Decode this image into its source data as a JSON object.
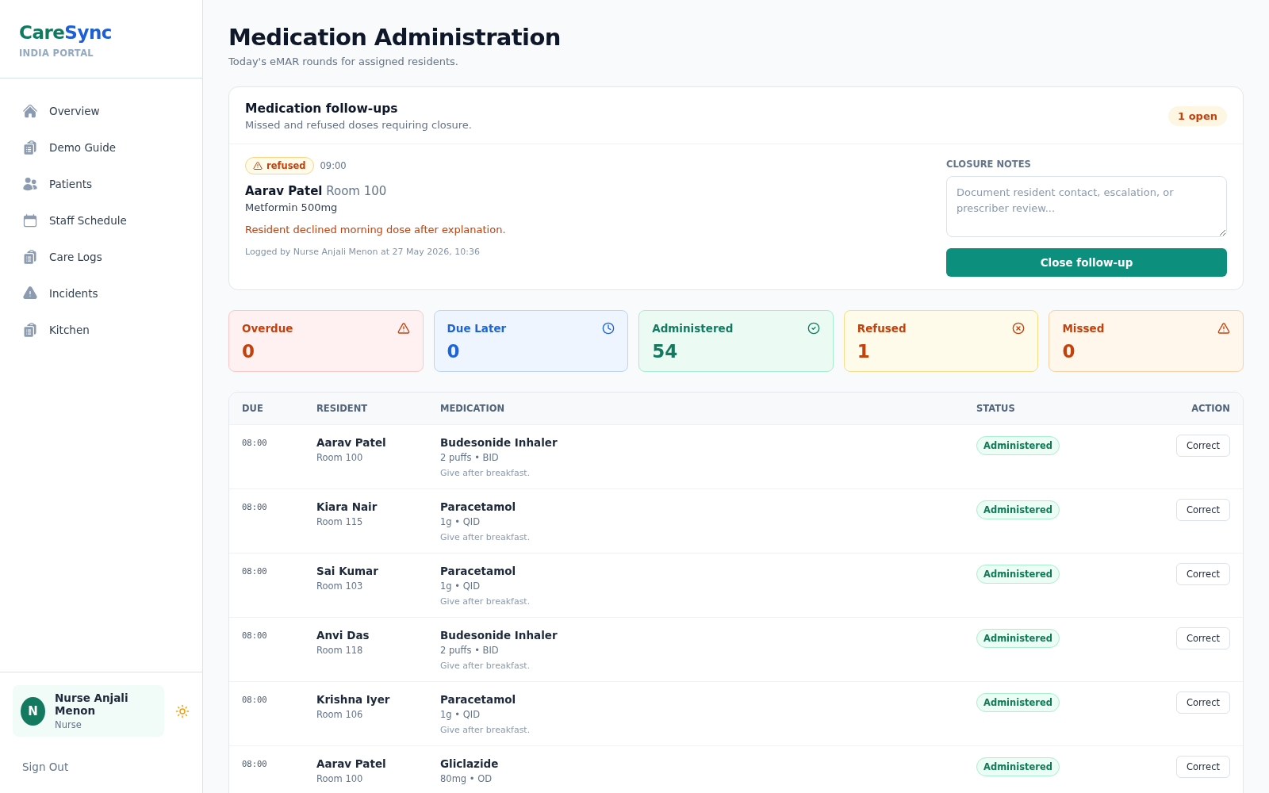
{
  "brand": {
    "name_a": "Care",
    "name_b": "Sync",
    "subtitle": "INDIA PORTAL"
  },
  "nav": [
    {
      "label": "Overview",
      "kind": "home"
    },
    {
      "label": "Demo Guide",
      "kind": "clipboard"
    },
    {
      "label": "Patients",
      "kind": "people"
    },
    {
      "label": "Staff Schedule",
      "kind": "calendar"
    },
    {
      "label": "Care Logs",
      "kind": "clipboard"
    },
    {
      "label": "Incidents",
      "kind": "alert"
    },
    {
      "label": "Kitchen",
      "kind": "clipboard"
    }
  ],
  "user": {
    "initial": "N",
    "name": "Nurse Anjali Menon",
    "role": "Nurse"
  },
  "sign_out": "Sign Out",
  "page": {
    "title": "Medication Administration",
    "subtitle": "Today's eMAR rounds for assigned residents."
  },
  "followups": {
    "title": "Medication follow-ups",
    "subtitle": "Missed and refused doses requiring closure.",
    "badge": "1 open",
    "item": {
      "status": "refused",
      "time": "09:00",
      "resident": "Aarav Patel",
      "room": "Room 100",
      "medication": "Metformin 500mg",
      "note": "Resident declined morning dose after explanation.",
      "logged": "Logged by Nurse Anjali Menon at 27 May 2026, 10:36"
    },
    "notes_label": "CLOSURE NOTES",
    "notes_placeholder": "Document resident contact, escalation, or prescriber review...",
    "button": "Close follow-up"
  },
  "stats": [
    {
      "label": "Overdue",
      "value": "0",
      "kind": "overdue"
    },
    {
      "label": "Due Later",
      "value": "0",
      "kind": "later"
    },
    {
      "label": "Administered",
      "value": "54",
      "kind": "administered"
    },
    {
      "label": "Refused",
      "value": "1",
      "kind": "refused"
    },
    {
      "label": "Missed",
      "value": "0",
      "kind": "missed"
    }
  ],
  "table": {
    "columns": [
      "DUE",
      "RESIDENT",
      "MEDICATION",
      "STATUS",
      "ACTION"
    ],
    "rows": [
      {
        "due": "08:00",
        "resident": "Aarav Patel",
        "room": "Room 100",
        "medication": "Budesonide Inhaler",
        "dose": "2 puffs • BID",
        "instructions": "Give after breakfast.",
        "status": "Administered",
        "action": "Correct"
      },
      {
        "due": "08:00",
        "resident": "Kiara Nair",
        "room": "Room 115",
        "medication": "Paracetamol",
        "dose": "1g • QID",
        "instructions": "Give after breakfast.",
        "status": "Administered",
        "action": "Correct"
      },
      {
        "due": "08:00",
        "resident": "Sai Kumar",
        "room": "Room 103",
        "medication": "Paracetamol",
        "dose": "1g • QID",
        "instructions": "Give after breakfast.",
        "status": "Administered",
        "action": "Correct"
      },
      {
        "due": "08:00",
        "resident": "Anvi Das",
        "room": "Room 118",
        "medication": "Budesonide Inhaler",
        "dose": "2 puffs • BID",
        "instructions": "Give after breakfast.",
        "status": "Administered",
        "action": "Correct"
      },
      {
        "due": "08:00",
        "resident": "Krishna Iyer",
        "room": "Room 106",
        "medication": "Paracetamol",
        "dose": "1g • QID",
        "instructions": "Give after breakfast.",
        "status": "Administered",
        "action": "Correct"
      },
      {
        "due": "08:00",
        "resident": "Aarav Patel",
        "room": "Room 100",
        "medication": "Gliclazide",
        "dose": "80mg • OD",
        "status": "Administered",
        "action": "Correct"
      }
    ]
  }
}
